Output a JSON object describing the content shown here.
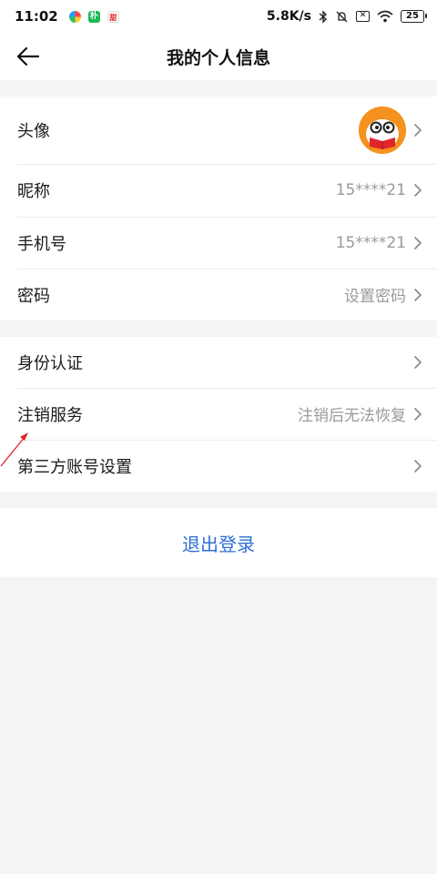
{
  "status_bar": {
    "time": "11:02",
    "app_icon_2": "朴",
    "app_icon_3": "甜",
    "net_speed": "5.8K/s",
    "battery": "25",
    "x_badge": "✕"
  },
  "header": {
    "title": "我的个人信息",
    "back_icon": "arrow-left-icon"
  },
  "profile_group": [
    {
      "label": "头像",
      "value": "",
      "type": "avatar"
    },
    {
      "label": "昵称",
      "value": "15****21"
    },
    {
      "label": "手机号",
      "value": "15****21"
    },
    {
      "label": "密码",
      "value": "设置密码"
    }
  ],
  "account_group": [
    {
      "label": "身份认证",
      "value": ""
    },
    {
      "label": "注销服务",
      "value": "注销后无法恢复"
    },
    {
      "label": "第三方账号设置",
      "value": ""
    }
  ],
  "logout_label": "退出登录",
  "colors": {
    "background": "#f4f4f6",
    "link": "#2e6fd6",
    "avatar": "#f5911e",
    "annotation": "#e0262a"
  }
}
